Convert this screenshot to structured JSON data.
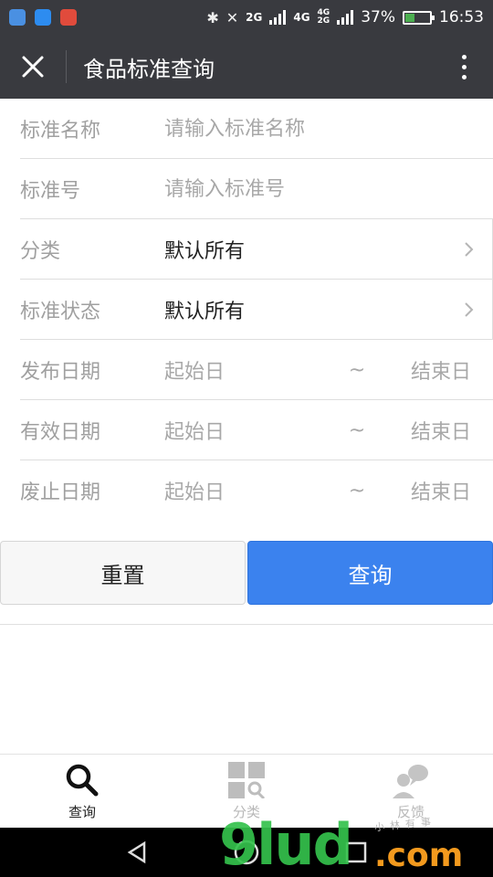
{
  "status_bar": {
    "network_a": "2G",
    "network_b": "4G",
    "network_c": "4G",
    "network_d": "2G",
    "battery": "37%",
    "time": "16:53",
    "app_colors": [
      "#4a90e2",
      "#2d8cf0",
      "#e14b3c"
    ]
  },
  "title_bar": {
    "title": "食品标准查询"
  },
  "form": {
    "standard_name": {
      "label": "标准名称",
      "placeholder": "请输入标准名称"
    },
    "standard_no": {
      "label": "标准号",
      "placeholder": "请输入标准号"
    },
    "category": {
      "label": "分类",
      "value": "默认所有"
    },
    "status": {
      "label": "标准状态",
      "value": "默认所有"
    },
    "publish_date": {
      "label": "发布日期",
      "start": "起始日",
      "sep": "~",
      "end": "结束日"
    },
    "effective_date": {
      "label": "有效日期",
      "start": "起始日",
      "sep": "~",
      "end": "结束日"
    },
    "abolish_date": {
      "label": "废止日期",
      "start": "起始日",
      "sep": "~",
      "end": "结束日"
    }
  },
  "buttons": {
    "reset": "重置",
    "query": "查询"
  },
  "tabs": [
    {
      "label": "查询",
      "icon": "search-icon",
      "active": true
    },
    {
      "label": "分类",
      "icon": "category-icon",
      "active": false
    },
    {
      "label": "反馈",
      "icon": "feedback-icon",
      "active": false
    }
  ],
  "watermark": {
    "logo": "9lud",
    "domain": ".com",
    "slogan": "小林有事"
  },
  "colors": {
    "header": "#393a3f",
    "primary": "#3b82ee"
  }
}
